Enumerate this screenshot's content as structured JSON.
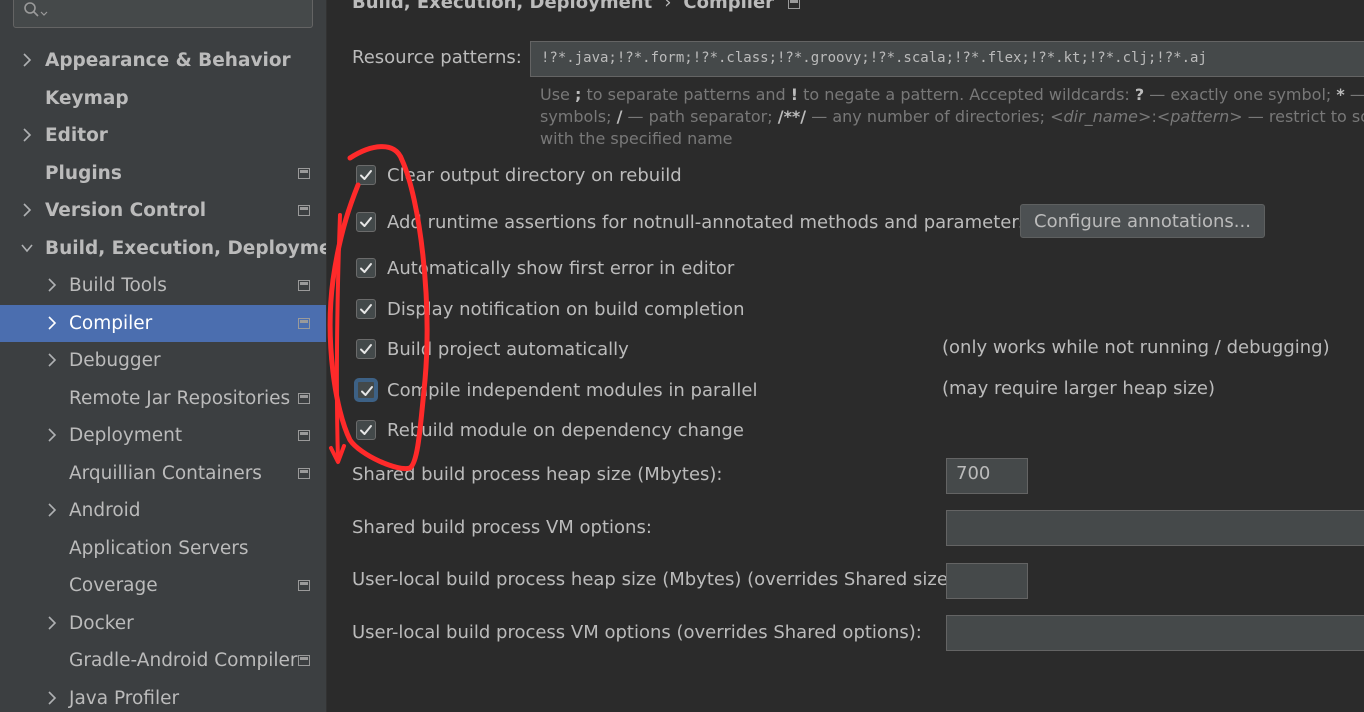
{
  "sidebar": {
    "search": {
      "placeholder": ""
    },
    "items": [
      {
        "label": "Appearance & Behavior",
        "level": 0,
        "expandable": true,
        "expanded": false,
        "project_icon": false,
        "selected": false
      },
      {
        "label": "Keymap",
        "level": 0,
        "expandable": false,
        "expanded": false,
        "project_icon": false,
        "selected": false
      },
      {
        "label": "Editor",
        "level": 0,
        "expandable": true,
        "expanded": false,
        "project_icon": false,
        "selected": false
      },
      {
        "label": "Plugins",
        "level": 0,
        "expandable": false,
        "expanded": false,
        "project_icon": true,
        "selected": false
      },
      {
        "label": "Version Control",
        "level": 0,
        "expandable": true,
        "expanded": false,
        "project_icon": true,
        "selected": false
      },
      {
        "label": "Build, Execution, Deployment",
        "level": 0,
        "expandable": true,
        "expanded": true,
        "project_icon": false,
        "selected": false
      },
      {
        "label": "Build Tools",
        "level": 1,
        "expandable": true,
        "expanded": false,
        "project_icon": true,
        "selected": false
      },
      {
        "label": "Compiler",
        "level": 1,
        "expandable": true,
        "expanded": false,
        "project_icon": true,
        "selected": true
      },
      {
        "label": "Debugger",
        "level": 1,
        "expandable": true,
        "expanded": false,
        "project_icon": false,
        "selected": false
      },
      {
        "label": "Remote Jar Repositories",
        "level": 1,
        "expandable": false,
        "expanded": false,
        "project_icon": true,
        "selected": false
      },
      {
        "label": "Deployment",
        "level": 1,
        "expandable": true,
        "expanded": false,
        "project_icon": true,
        "selected": false
      },
      {
        "label": "Arquillian Containers",
        "level": 1,
        "expandable": false,
        "expanded": false,
        "project_icon": true,
        "selected": false
      },
      {
        "label": "Android",
        "level": 1,
        "expandable": true,
        "expanded": false,
        "project_icon": false,
        "selected": false
      },
      {
        "label": "Application Servers",
        "level": 1,
        "expandable": false,
        "expanded": false,
        "project_icon": false,
        "selected": false
      },
      {
        "label": "Coverage",
        "level": 1,
        "expandable": false,
        "expanded": false,
        "project_icon": true,
        "selected": false
      },
      {
        "label": "Docker",
        "level": 1,
        "expandable": true,
        "expanded": false,
        "project_icon": false,
        "selected": false
      },
      {
        "label": "Gradle-Android Compiler",
        "level": 1,
        "expandable": false,
        "expanded": false,
        "project_icon": true,
        "selected": false
      },
      {
        "label": "Java Profiler",
        "level": 1,
        "expandable": true,
        "expanded": false,
        "project_icon": false,
        "selected": false
      }
    ]
  },
  "breadcrumb": {
    "parent": "Build, Execution, Deployment",
    "separator": "›",
    "current": "Compiler"
  },
  "resource_patterns": {
    "label": "Resource patterns:",
    "value": "!?*.java;!?*.form;!?*.class;!?*.groovy;!?*.scala;!?*.flex;!?*.kt;!?*.clj;!?*.aj"
  },
  "hint": {
    "l1_a": "Use ",
    "l1_semicolon": ";",
    "l1_b": " to separate patterns and ",
    "l1_bang": "!",
    "l1_c": " to negate a pattern. Accepted wildcards: ",
    "l1_q": "?",
    "l1_d": " — exactly one symbol; ",
    "l1_star": "*",
    "l1_e": " — zero",
    "l2_a": "symbols; ",
    "l2_slash": "/",
    "l2_b": " — path separator; ",
    "l2_dstar": "/**/",
    "l2_c": " — any number of directories; ",
    "l2_dir": "<dir_name>",
    "l2_colon": ":",
    "l2_pattern": "<pattern>",
    "l2_d": " — restrict to source",
    "l3": "with the specified name"
  },
  "options": [
    {
      "label": "Clear output directory on rebuild",
      "checked": true,
      "focused": false,
      "note": ""
    },
    {
      "label": "Add runtime assertions for notnull-annotated methods and parameters",
      "checked": true,
      "focused": false,
      "note": ""
    },
    {
      "label": "Automatically show first error in editor",
      "checked": true,
      "focused": false,
      "note": ""
    },
    {
      "label": "Display notification on build completion",
      "checked": true,
      "focused": false,
      "note": ""
    },
    {
      "label": "Build project automatically",
      "checked": true,
      "focused": false,
      "note": "(only works while not running / debugging)"
    },
    {
      "label": "Compile independent modules in parallel",
      "checked": true,
      "focused": true,
      "note": "(may require larger heap size)"
    },
    {
      "label": "Rebuild module on dependency change",
      "checked": true,
      "focused": false,
      "note": ""
    }
  ],
  "configure_annotations_button": "Configure annotations...",
  "fields": {
    "shared_heap": {
      "label": "Shared build process heap size (Mbytes):",
      "value": "700"
    },
    "shared_vm": {
      "label": "Shared build process VM options:",
      "value": ""
    },
    "local_heap": {
      "label": "User-local build process heap size (Mbytes) (overrides Shared size):",
      "value": ""
    },
    "local_vm": {
      "label": "User-local build process VM options (overrides Shared options):",
      "value": ""
    }
  },
  "colors": {
    "background": "#2b2b2b",
    "sidebar": "#3c3f41",
    "selection": "#4b6eaf",
    "annotation": "#ff2a2a"
  }
}
